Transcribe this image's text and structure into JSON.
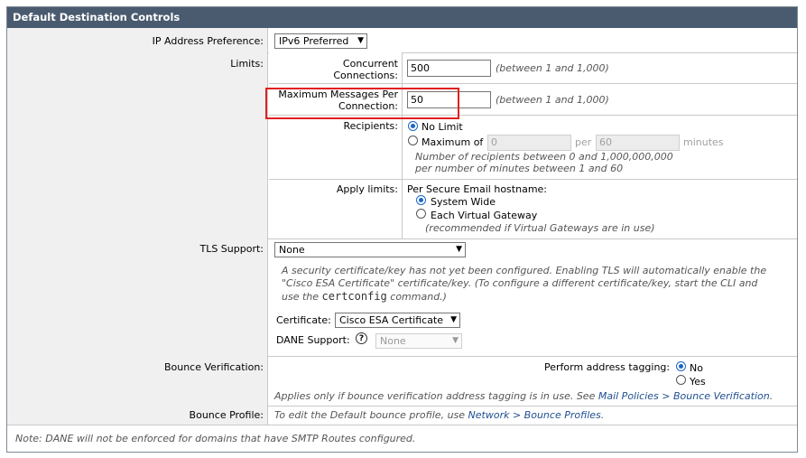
{
  "section_title": "Default Destination Controls",
  "ip_pref": {
    "label": "IP Address Preference:",
    "value": "IPv6 Preferred"
  },
  "limits": {
    "label": "Limits:",
    "concurrent": {
      "label_line1": "Concurrent",
      "label_line2": "Connections:",
      "value": "500",
      "hint": "(between 1 and 1,000)"
    },
    "max_messages": {
      "label_line1": "Maximum Messages Per",
      "label_line2": "Connection:",
      "value": "50",
      "hint": "(between 1 and 1,000)"
    },
    "recipients": {
      "label": "Recipients:",
      "no_limit": "No Limit",
      "maximum_of": "Maximum of",
      "max_value": "0",
      "per": "per",
      "per_value": "60",
      "minutes": "minutes",
      "note_line1": "Number of recipients between 0 and 1,000,000,000",
      "note_line2": "per number of minutes between 1 and 60"
    },
    "apply": {
      "label": "Apply limits:",
      "heading": "Per Secure Email hostname:",
      "system_wide": "System Wide",
      "each_gateway": "Each Virtual Gateway",
      "note": "(recommended if Virtual Gateways are in use)"
    }
  },
  "tls": {
    "label": "TLS Support:",
    "value": "None",
    "info_line1": "A security certificate/key has not yet been configured. Enabling TLS will automatically enable the",
    "info_line2": "\"Cisco ESA Certificate\" certificate/key. (To configure a different certificate/key, start the CLI and",
    "info_line3_pre": "use the",
    "info_line3_code": "certconfig",
    "info_line3_post": "command.)",
    "certificate_label": "Certificate:",
    "certificate_value": "Cisco ESA Certificate",
    "dane_label": "DANE Support:",
    "dane_value": "None"
  },
  "bounce_verification": {
    "label": "Bounce Verification:",
    "tagging_label": "Perform address tagging:",
    "no": "No",
    "yes": "Yes",
    "note_pre": "Applies only if bounce verification address tagging is in use. See",
    "note_link": "Mail Policies > Bounce Verification",
    "note_post": "."
  },
  "bounce_profile": {
    "label": "Bounce Profile:",
    "text_pre": "To edit the Default bounce profile, use",
    "link": "Network > Bounce Profiles",
    "text_post": "."
  },
  "footer_note": "Note: DANE will not be enforced for domains that have SMTP Routes configured.",
  "colors": {
    "title_bg": "#4a5a6f",
    "highlight": "#e02020",
    "radio_accent": "#1a66c9",
    "link": "#1f4f8f"
  }
}
